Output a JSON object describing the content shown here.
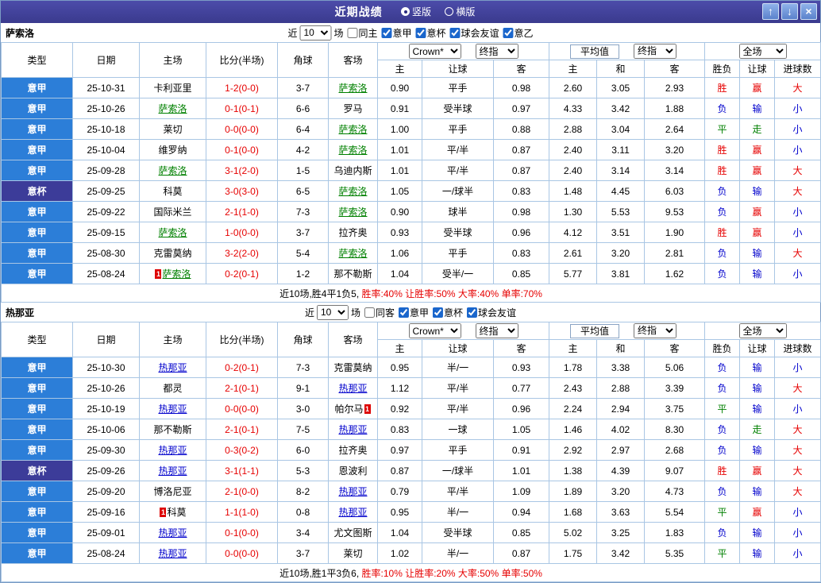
{
  "header": {
    "title": "近期战绩",
    "vertical_label": "竖版",
    "horizontal_label": "横版",
    "up_icon": "↑",
    "down_icon": "↓",
    "close_icon": "×"
  },
  "table_header": {
    "type": "类型",
    "date": "日期",
    "home": "主场",
    "score": "比分(半场)",
    "corner": "角球",
    "away": "客场",
    "bookmaker_select": "Crown*",
    "final_odds_select": "终指",
    "average_label": "平均值",
    "average_final_select": "终指",
    "scope_select": "全场",
    "sub_headers": [
      "主",
      "让球",
      "客",
      "主",
      "和",
      "客",
      "胜负",
      "让球",
      "进球数"
    ]
  },
  "colors": {
    "red": "#e60000",
    "blue": "#0000cc",
    "green": "#008000",
    "league_bg": "#2c7ed8",
    "cup_bg": "#3c3c99",
    "score": "#e60000",
    "card": "#dd0000"
  },
  "result_color_map": {
    "胜": "red",
    "负": "blue",
    "平": "green",
    "赢": "red",
    "输": "blue",
    "走": "green",
    "大": "red",
    "小": "blue"
  },
  "sections": [
    {
      "team": "萨索洛",
      "team_color": "#008000",
      "filter": {
        "near_label": "近",
        "count": "10",
        "games_label": "场",
        "checkboxes": [
          {
            "label": "同主",
            "checked": false
          },
          {
            "label": "意甲",
            "checked": true
          },
          {
            "label": "意杯",
            "checked": true
          },
          {
            "label": "球会友谊",
            "checked": true
          },
          {
            "label": "意乙",
            "checked": true
          }
        ]
      },
      "rows": [
        {
          "league": "意甲",
          "cup": false,
          "date": "25-10-31",
          "home": "卡利亚里",
          "home_self": false,
          "home_card": null,
          "score": "1-2(0-0)",
          "corner": "3-7",
          "away": "萨索洛",
          "away_self": true,
          "away_card": null,
          "odds": [
            "0.90",
            "平手",
            "0.98"
          ],
          "avg": [
            "2.60",
            "3.05",
            "2.93"
          ],
          "result": "胜",
          "handicap_result": "赢",
          "goals": "大"
        },
        {
          "league": "意甲",
          "cup": false,
          "date": "25-10-26",
          "home": "萨索洛",
          "home_self": true,
          "home_card": null,
          "score": "0-1(0-1)",
          "corner": "6-6",
          "away": "罗马",
          "away_self": false,
          "away_card": null,
          "odds": [
            "0.91",
            "受半球",
            "0.97"
          ],
          "avg": [
            "4.33",
            "3.42",
            "1.88"
          ],
          "result": "负",
          "handicap_result": "输",
          "goals": "小"
        },
        {
          "league": "意甲",
          "cup": false,
          "date": "25-10-18",
          "home": "莱切",
          "home_self": false,
          "home_card": null,
          "score": "0-0(0-0)",
          "corner": "6-4",
          "away": "萨索洛",
          "away_self": true,
          "away_card": null,
          "odds": [
            "1.00",
            "平手",
            "0.88"
          ],
          "avg": [
            "2.88",
            "3.04",
            "2.64"
          ],
          "result": "平",
          "handicap_result": "走",
          "goals": "小"
        },
        {
          "league": "意甲",
          "cup": false,
          "date": "25-10-04",
          "home": "维罗纳",
          "home_self": false,
          "home_card": null,
          "score": "0-1(0-0)",
          "corner": "4-2",
          "away": "萨索洛",
          "away_self": true,
          "away_card": null,
          "odds": [
            "1.01",
            "平/半",
            "0.87"
          ],
          "avg": [
            "2.40",
            "3.11",
            "3.20"
          ],
          "result": "胜",
          "handicap_result": "赢",
          "goals": "小"
        },
        {
          "league": "意甲",
          "cup": false,
          "date": "25-09-28",
          "home": "萨索洛",
          "home_self": true,
          "home_card": null,
          "score": "3-1(2-0)",
          "corner": "1-5",
          "away": "乌迪内斯",
          "away_self": false,
          "away_card": null,
          "odds": [
            "1.01",
            "平/半",
            "0.87"
          ],
          "avg": [
            "2.40",
            "3.14",
            "3.14"
          ],
          "result": "胜",
          "handicap_result": "赢",
          "goals": "大"
        },
        {
          "league": "意杯",
          "cup": true,
          "date": "25-09-25",
          "home": "科莫",
          "home_self": false,
          "home_card": null,
          "score": "3-0(3-0)",
          "corner": "6-5",
          "away": "萨索洛",
          "away_self": true,
          "away_card": null,
          "odds": [
            "1.05",
            "一/球半",
            "0.83"
          ],
          "avg": [
            "1.48",
            "4.45",
            "6.03"
          ],
          "result": "负",
          "handicap_result": "输",
          "goals": "大"
        },
        {
          "league": "意甲",
          "cup": false,
          "date": "25-09-22",
          "home": "国际米兰",
          "home_self": false,
          "home_card": null,
          "score": "2-1(1-0)",
          "corner": "7-3",
          "away": "萨索洛",
          "away_self": true,
          "away_card": null,
          "odds": [
            "0.90",
            "球半",
            "0.98"
          ],
          "avg": [
            "1.30",
            "5.53",
            "9.53"
          ],
          "result": "负",
          "handicap_result": "赢",
          "goals": "小"
        },
        {
          "league": "意甲",
          "cup": false,
          "date": "25-09-15",
          "home": "萨索洛",
          "home_self": true,
          "home_card": null,
          "score": "1-0(0-0)",
          "corner": "3-7",
          "away": "拉齐奥",
          "away_self": false,
          "away_card": null,
          "odds": [
            "0.93",
            "受半球",
            "0.96"
          ],
          "avg": [
            "4.12",
            "3.51",
            "1.90"
          ],
          "result": "胜",
          "handicap_result": "赢",
          "goals": "小"
        },
        {
          "league": "意甲",
          "cup": false,
          "date": "25-08-30",
          "home": "克雷莫纳",
          "home_self": false,
          "home_card": null,
          "score": "3-2(2-0)",
          "corner": "5-4",
          "away": "萨索洛",
          "away_self": true,
          "away_card": null,
          "odds": [
            "1.06",
            "平手",
            "0.83"
          ],
          "avg": [
            "2.61",
            "3.20",
            "2.81"
          ],
          "result": "负",
          "handicap_result": "输",
          "goals": "大"
        },
        {
          "league": "意甲",
          "cup": false,
          "date": "25-08-24",
          "home": "萨索洛",
          "home_self": true,
          "home_card": "1",
          "score": "0-2(0-1)",
          "corner": "1-2",
          "away": "那不勒斯",
          "away_self": false,
          "away_card": null,
          "odds": [
            "1.04",
            "受半/一",
            "0.85"
          ],
          "avg": [
            "5.77",
            "3.81",
            "1.62"
          ],
          "result": "负",
          "handicap_result": "输",
          "goals": "小"
        }
      ],
      "summary": {
        "record": "近10场,胜4平1负5,",
        "rates": " 胜率:40% 让胜率:50% 大率:40% 单率:70%"
      }
    },
    {
      "team": "热那亚",
      "team_color": "#0000cc",
      "filter": {
        "near_label": "近",
        "count": "10",
        "games_label": "场",
        "checkboxes": [
          {
            "label": "同客",
            "checked": false
          },
          {
            "label": "意甲",
            "checked": true
          },
          {
            "label": "意杯",
            "checked": true
          },
          {
            "label": "球会友谊",
            "checked": true
          }
        ]
      },
      "rows": [
        {
          "league": "意甲",
          "cup": false,
          "date": "25-10-30",
          "home": "热那亚",
          "home_self": true,
          "home_card": null,
          "score": "0-2(0-1)",
          "corner": "7-3",
          "away": "克雷莫纳",
          "away_self": false,
          "away_card": null,
          "odds": [
            "0.95",
            "半/一",
            "0.93"
          ],
          "avg": [
            "1.78",
            "3.38",
            "5.06"
          ],
          "result": "负",
          "handicap_result": "输",
          "goals": "小"
        },
        {
          "league": "意甲",
          "cup": false,
          "date": "25-10-26",
          "home": "都灵",
          "home_self": false,
          "home_card": null,
          "score": "2-1(0-1)",
          "corner": "9-1",
          "away": "热那亚",
          "away_self": true,
          "away_card": null,
          "odds": [
            "1.12",
            "平/半",
            "0.77"
          ],
          "avg": [
            "2.43",
            "2.88",
            "3.39"
          ],
          "result": "负",
          "handicap_result": "输",
          "goals": "大"
        },
        {
          "league": "意甲",
          "cup": false,
          "date": "25-10-19",
          "home": "热那亚",
          "home_self": true,
          "home_card": null,
          "score": "0-0(0-0)",
          "corner": "3-0",
          "away": "帕尔马",
          "away_self": false,
          "away_card": "1",
          "odds": [
            "0.92",
            "平/半",
            "0.96"
          ],
          "avg": [
            "2.24",
            "2.94",
            "3.75"
          ],
          "result": "平",
          "handicap_result": "输",
          "goals": "小"
        },
        {
          "league": "意甲",
          "cup": false,
          "date": "25-10-06",
          "home": "那不勒斯",
          "home_self": false,
          "home_card": null,
          "score": "2-1(0-1)",
          "corner": "7-5",
          "away": "热那亚",
          "away_self": true,
          "away_card": null,
          "odds": [
            "0.83",
            "一球",
            "1.05"
          ],
          "avg": [
            "1.46",
            "4.02",
            "8.30"
          ],
          "result": "负",
          "handicap_result": "走",
          "goals": "大"
        },
        {
          "league": "意甲",
          "cup": false,
          "date": "25-09-30",
          "home": "热那亚",
          "home_self": true,
          "home_card": null,
          "score": "0-3(0-2)",
          "corner": "6-0",
          "away": "拉齐奥",
          "away_self": false,
          "away_card": null,
          "odds": [
            "0.97",
            "平手",
            "0.91"
          ],
          "avg": [
            "2.92",
            "2.97",
            "2.68"
          ],
          "result": "负",
          "handicap_result": "输",
          "goals": "大"
        },
        {
          "league": "意杯",
          "cup": true,
          "date": "25-09-26",
          "home": "热那亚",
          "home_self": true,
          "home_card": null,
          "score": "3-1(1-1)",
          "corner": "5-3",
          "away": "恩波利",
          "away_self": false,
          "away_card": null,
          "odds": [
            "0.87",
            "一/球半",
            "1.01"
          ],
          "avg": [
            "1.38",
            "4.39",
            "9.07"
          ],
          "result": "胜",
          "handicap_result": "赢",
          "goals": "大"
        },
        {
          "league": "意甲",
          "cup": false,
          "date": "25-09-20",
          "home": "博洛尼亚",
          "home_self": false,
          "home_card": null,
          "score": "2-1(0-0)",
          "corner": "8-2",
          "away": "热那亚",
          "away_self": true,
          "away_card": null,
          "odds": [
            "0.79",
            "平/半",
            "1.09"
          ],
          "avg": [
            "1.89",
            "3.20",
            "4.73"
          ],
          "result": "负",
          "handicap_result": "输",
          "goals": "大"
        },
        {
          "league": "意甲",
          "cup": false,
          "date": "25-09-16",
          "home": "科莫",
          "home_self": false,
          "home_card": "1",
          "score": "1-1(1-0)",
          "corner": "0-8",
          "away": "热那亚",
          "away_self": true,
          "away_card": null,
          "odds": [
            "0.95",
            "半/一",
            "0.94"
          ],
          "avg": [
            "1.68",
            "3.63",
            "5.54"
          ],
          "result": "平",
          "handicap_result": "赢",
          "goals": "小"
        },
        {
          "league": "意甲",
          "cup": false,
          "date": "25-09-01",
          "home": "热那亚",
          "home_self": true,
          "home_card": null,
          "score": "0-1(0-0)",
          "corner": "3-4",
          "away": "尤文图斯",
          "away_self": false,
          "away_card": null,
          "odds": [
            "1.04",
            "受半球",
            "0.85"
          ],
          "avg": [
            "5.02",
            "3.25",
            "1.83"
          ],
          "result": "负",
          "handicap_result": "输",
          "goals": "小"
        },
        {
          "league": "意甲",
          "cup": false,
          "date": "25-08-24",
          "home": "热那亚",
          "home_self": true,
          "home_card": null,
          "score": "0-0(0-0)",
          "corner": "3-7",
          "away": "莱切",
          "away_self": false,
          "away_card": null,
          "odds": [
            "1.02",
            "半/一",
            "0.87"
          ],
          "avg": [
            "1.75",
            "3.42",
            "5.35"
          ],
          "result": "平",
          "handicap_result": "输",
          "goals": "小"
        }
      ],
      "summary": {
        "record": "近10场,胜1平3负6,",
        "rates": " 胜率:10% 让胜率:20% 大率:50% 单率:50%"
      }
    }
  ]
}
